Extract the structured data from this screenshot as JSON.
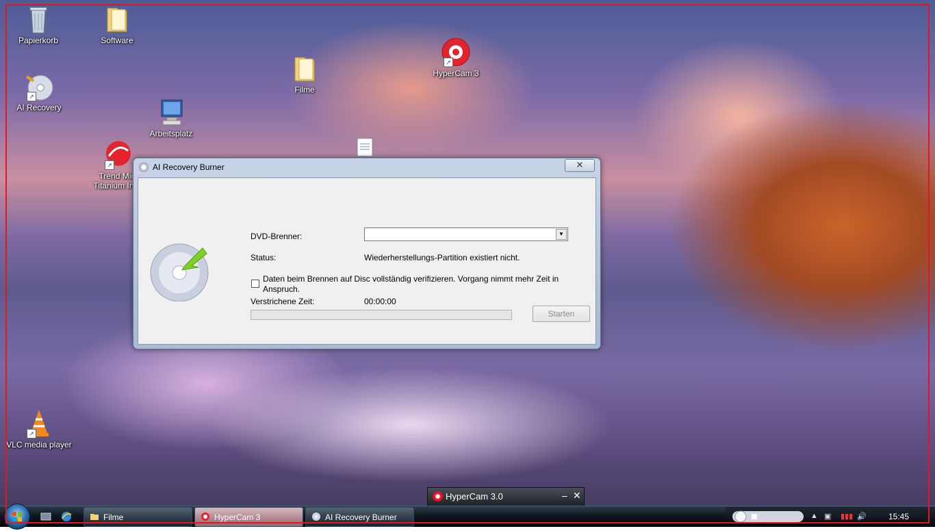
{
  "desktop": {
    "icons": {
      "recycle_bin": "Papierkorb",
      "software": "Software",
      "ai_recovery": "AI Recovery",
      "filme": "Filme",
      "hypercam": "HyperCam 3",
      "arbeitsplatz": "Arbeitsplatz",
      "trend_line1": "Trend Mic",
      "trend_line2": "Titanium Inte",
      "vlc": "VLC media player"
    }
  },
  "dialog": {
    "title": "AI Recovery Burner",
    "close_label": "✕",
    "dvd_label": "DVD-Brenner:",
    "dvd_value": "",
    "status_label": "Status:",
    "status_value": "Wiederherstellungs-Partition existiert nicht.",
    "verify_label": "Daten beim Brennen auf Disc vollständig verifizieren. Vorgang nimmt mehr Zeit in Anspruch.",
    "verify_checked": false,
    "elapsed_label": "Verstrichene Zeit:",
    "elapsed_value": "00:00:00",
    "progress_fraction": 0,
    "start_button": "Starten"
  },
  "hypercam_mini": {
    "title": "HyperCam 3.0",
    "minimize": "–",
    "close": "✕"
  },
  "taskbar": {
    "buttons": [
      {
        "label": "Filme"
      },
      {
        "label": "HyperCam 3"
      },
      {
        "label": "AI Recovery Burner"
      }
    ],
    "clock": "15:45"
  },
  "colors": {
    "frame": "#e01822",
    "progress": "#4ec24e"
  }
}
